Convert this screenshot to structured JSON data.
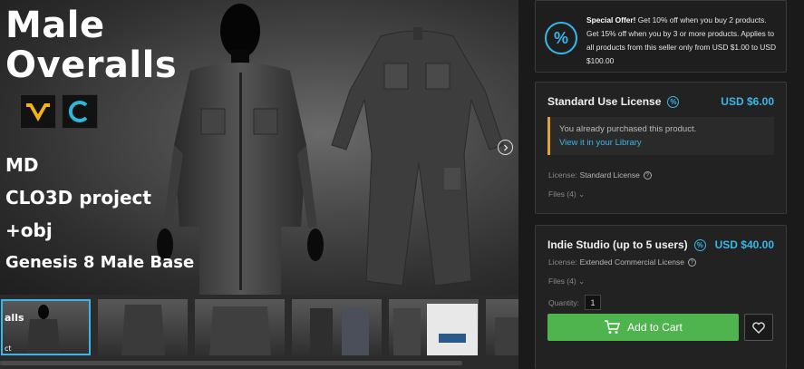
{
  "gallery": {
    "title_lines": [
      "Male",
      "Overalls"
    ],
    "feature_lines": [
      "MD",
      "CLO3D project",
      "+obj",
      "Genesis 8 Male Base"
    ],
    "logos": [
      "marvelous-designer-logo",
      "clo3d-logo"
    ],
    "thumb_label": "alls",
    "thumb_label2": "ct",
    "thumbnails": 6,
    "active_thumbnail": 1
  },
  "offer": {
    "heading": "Special Offer!",
    "text": "Get 10% off when you buy 2 products. Get 15% off when you by 3 or more products. Applies to all products from this seller only from USD $1.00 to USD $100.00",
    "icon": "percent-icon"
  },
  "licenses": [
    {
      "name": "Standard Use License",
      "price": "USD $6.00",
      "owned_message": "You already purchased this product.",
      "owned_link": "View it in your Library",
      "license_label": "License:",
      "license_value": "Standard License",
      "files": "Files (4)"
    },
    {
      "name": "Indie Studio (up to 5 users)",
      "price": "USD $40.00",
      "license_label": "License:",
      "license_value": "Extended Commercial License",
      "files": "Files (4)",
      "quantity_label": "Quantity:",
      "quantity_value": "1",
      "add_to_cart": "Add to Cart"
    }
  ],
  "colors": {
    "accent": "#3ab6e8",
    "cart_green": "#4fb34e",
    "owned_border": "#e0a33a"
  }
}
